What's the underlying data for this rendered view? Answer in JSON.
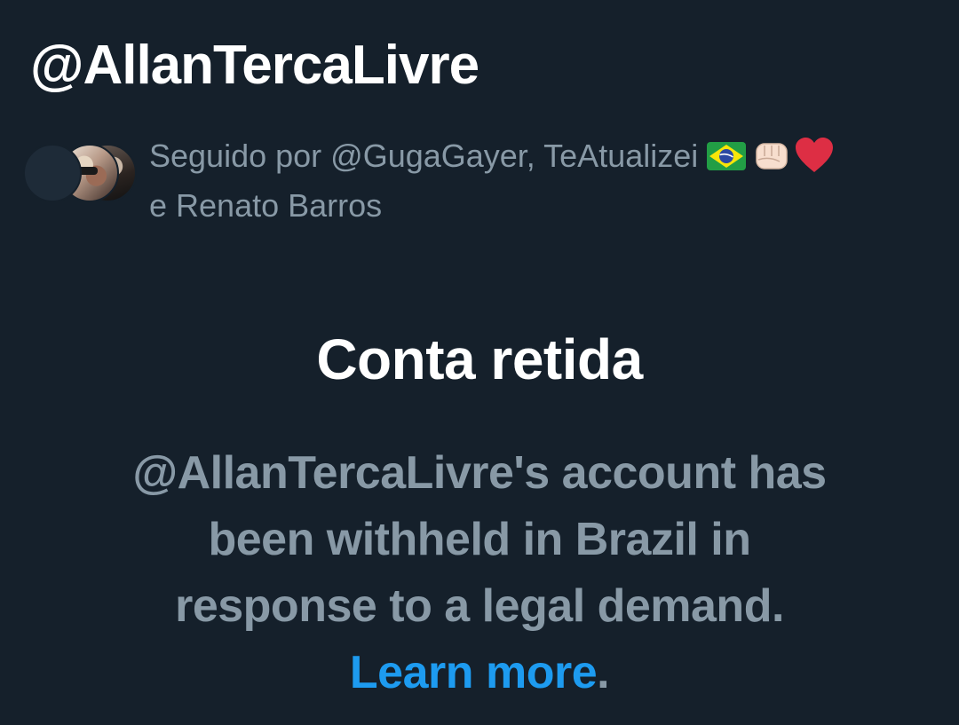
{
  "profile": {
    "handle": "@AllanTercaLivre"
  },
  "followers": {
    "line1": "Seguido por @GugaGayer, TeAtualizei",
    "line2": "e Renato Barros",
    "emojis": [
      "brazil-flag",
      "fist",
      "red-heart"
    ]
  },
  "withheld": {
    "title": "Conta retida",
    "message": "@AllanTercaLivre's account has been withheld in Brazil in response to a legal demand.",
    "link_label": "Learn more",
    "period": "."
  },
  "colors": {
    "background": "#15202b",
    "primary_text": "#ffffff",
    "secondary_text": "#8899a6",
    "link": "#1d9bf0"
  }
}
